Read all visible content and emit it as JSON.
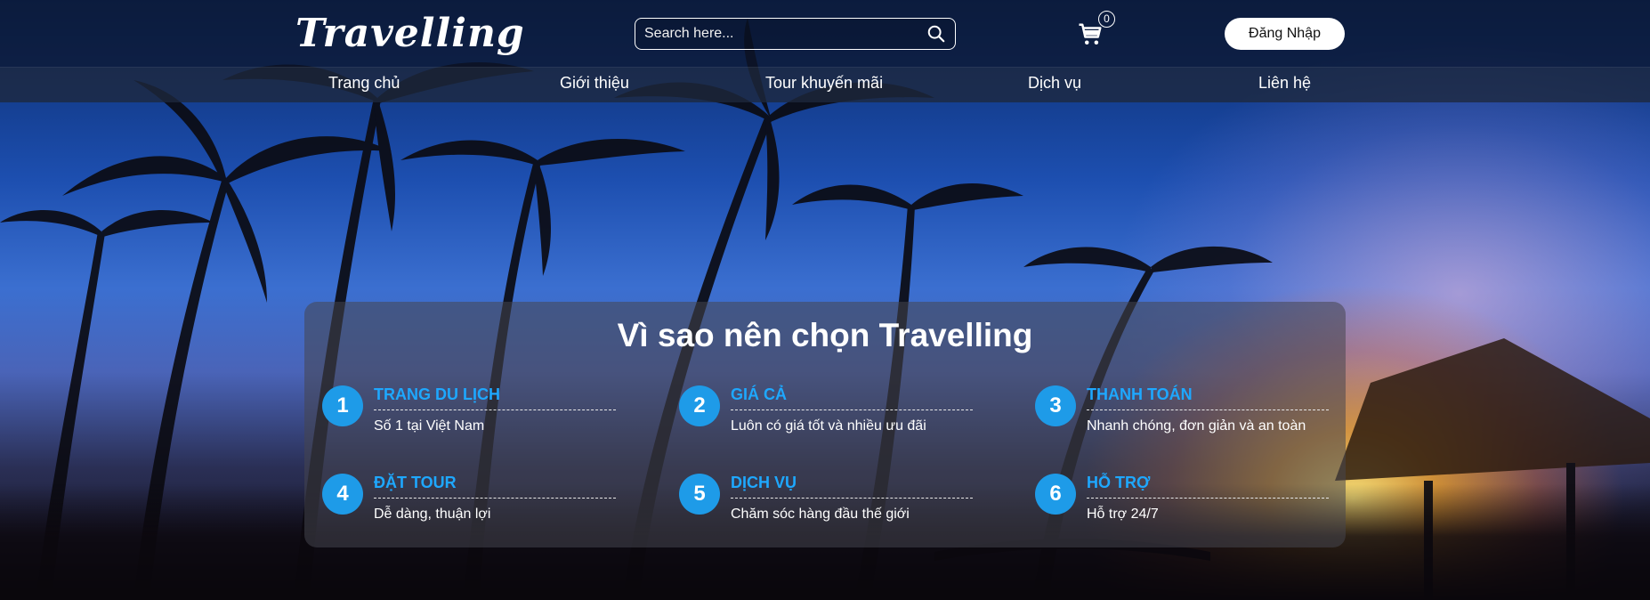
{
  "brand": {
    "name": "Travelling"
  },
  "search": {
    "placeholder": "Search here..."
  },
  "cart": {
    "count": "0"
  },
  "login": {
    "label": "Đăng Nhập"
  },
  "nav": {
    "items": [
      {
        "label": "Trang chủ"
      },
      {
        "label": "Giới thiệu"
      },
      {
        "label": "Tour khuyến mãi"
      },
      {
        "label": "Dịch vụ"
      },
      {
        "label": "Liên hệ"
      }
    ]
  },
  "why": {
    "title": "Vì sao nên chọn Travelling",
    "features": [
      {
        "num": "1",
        "title": "TRANG DU LỊCH",
        "desc": "Số 1 tại Việt Nam"
      },
      {
        "num": "2",
        "title": "GIÁ CẢ",
        "desc": "Luôn có giá tốt và nhiều ưu đãi"
      },
      {
        "num": "3",
        "title": "THANH TOÁN",
        "desc": "Nhanh chóng, đơn giản và an toàn"
      },
      {
        "num": "4",
        "title": "ĐẶT TOUR",
        "desc": "Dễ dàng, thuận lợi"
      },
      {
        "num": "5",
        "title": "DỊCH VỤ",
        "desc": "Chăm sóc hàng đầu thế giới"
      },
      {
        "num": "6",
        "title": "HỖ TRỢ",
        "desc": "Hỗ trợ 24/7"
      }
    ]
  },
  "colors": {
    "accent": "#1e9be8",
    "feature_title": "#1ea8ff"
  }
}
